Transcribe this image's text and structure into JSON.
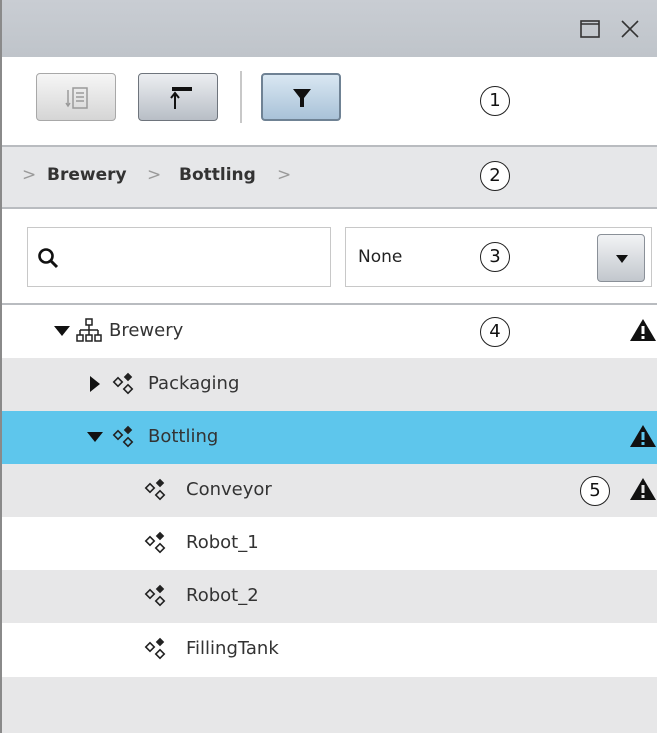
{
  "window": {
    "buttons": [
      {
        "icon": "maximize-icon"
      },
      {
        "icon": "close-icon"
      }
    ]
  },
  "toolbar": {
    "buttons": [
      {
        "icon": "collapse-all-icon",
        "state": "disabled"
      },
      {
        "icon": "go-to-top-icon",
        "state": "normal"
      },
      {
        "icon": "filter-icon",
        "state": "active"
      }
    ]
  },
  "callouts": [
    "1",
    "2",
    "3",
    "4",
    "5"
  ],
  "breadcrumb": {
    "items": [
      "Brewery",
      "Bottling"
    ]
  },
  "filter": {
    "search_placeholder": "",
    "dropdown_value": "None"
  },
  "tree": {
    "rows": [
      {
        "label": "Brewery",
        "level": 0,
        "expander": "expanded",
        "icon": "hierarchy-icon",
        "warning": true,
        "selected": false
      },
      {
        "label": "Packaging",
        "level": 1,
        "expander": "collapsed",
        "icon": "object-icon",
        "warning": false,
        "selected": false
      },
      {
        "label": "Bottling",
        "level": 1,
        "expander": "expanded",
        "icon": "object-icon",
        "warning": true,
        "selected": true
      },
      {
        "label": "Conveyor",
        "level": 2,
        "expander": "none",
        "icon": "object-icon",
        "warning": true,
        "selected": false
      },
      {
        "label": "Robot_1",
        "level": 2,
        "expander": "none",
        "icon": "object-icon",
        "warning": false,
        "selected": false
      },
      {
        "label": "Robot_2",
        "level": 2,
        "expander": "none",
        "icon": "object-icon",
        "warning": false,
        "selected": false
      },
      {
        "label": "FillingTank",
        "level": 2,
        "expander": "none",
        "icon": "object-icon",
        "warning": false,
        "selected": false
      }
    ]
  },
  "colors": {
    "selection": "#5ec6ec",
    "title_bar": "#c5c9cf",
    "row_alt": "#e7e7e8"
  }
}
